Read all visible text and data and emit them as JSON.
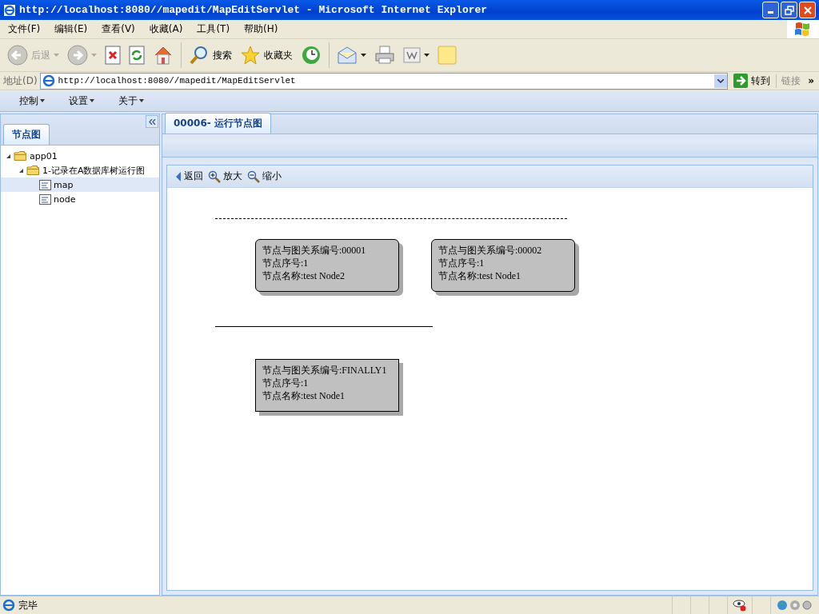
{
  "window": {
    "title": "http://localhost:8080//mapedit/MapEditServlet - Microsoft Internet Explorer"
  },
  "menu": [
    "文件(F)",
    "编辑(E)",
    "查看(V)",
    "收藏(A)",
    "工具(T)",
    "帮助(H)"
  ],
  "toolbar": [
    {
      "kind": "back",
      "label": "后退",
      "disabled": true
    },
    {
      "kind": "forward",
      "disabled": true
    },
    {
      "kind": "stop"
    },
    {
      "kind": "refresh"
    },
    {
      "kind": "home"
    },
    {
      "kind": "separator"
    },
    {
      "kind": "search",
      "label": "搜索"
    },
    {
      "kind": "favorites",
      "label": "收藏夹"
    },
    {
      "kind": "history"
    },
    {
      "kind": "separator"
    },
    {
      "kind": "mail"
    },
    {
      "kind": "print"
    },
    {
      "kind": "word"
    },
    {
      "kind": "note"
    }
  ],
  "address": {
    "label": "地址(D)",
    "url": "http://localhost:8080//mapedit/MapEditServlet",
    "go": "转到",
    "links": "链接",
    "more": "»"
  },
  "app_menu": [
    "控制",
    "设置",
    "关于"
  ],
  "sidebar": {
    "tab": "节点图",
    "tree": [
      {
        "label": "app01",
        "kind": "folder",
        "expanded": true,
        "selected": false,
        "children": [
          {
            "label": "1-记录在A数据库树运行图",
            "kind": "folder",
            "expanded": true,
            "selected": false,
            "children": [
              {
                "label": "map",
                "kind": "page",
                "selected": true
              },
              {
                "label": "node",
                "kind": "page",
                "selected": false
              }
            ]
          }
        ]
      }
    ]
  },
  "main": {
    "tab": {
      "label": "00006- 运行节点图",
      "selected": true
    },
    "actions": [
      {
        "kind": "back",
        "label": "返回"
      },
      {
        "kind": "zoom-in",
        "label": "放大"
      },
      {
        "kind": "zoom-out",
        "label": "缩小"
      }
    ],
    "diagram": {
      "lines": [
        {
          "kind": "dashed"
        },
        {
          "kind": "solid"
        }
      ],
      "nodes": [
        {
          "kind": "rounded",
          "lines": [
            "节点与图关系编号:00001",
            "节点序号:1",
            "节点名称:test Node2"
          ]
        },
        {
          "kind": "rounded",
          "lines": [
            "节点与图关系编号:00002",
            "节点序号:1",
            "节点名称:test Node1"
          ]
        },
        {
          "kind": "square",
          "lines": [
            "节点与图关系编号:FINALLY1",
            "节点序号:1",
            "节点名称:test Node1"
          ]
        }
      ]
    }
  },
  "status_bar": {
    "text": "完毕"
  }
}
